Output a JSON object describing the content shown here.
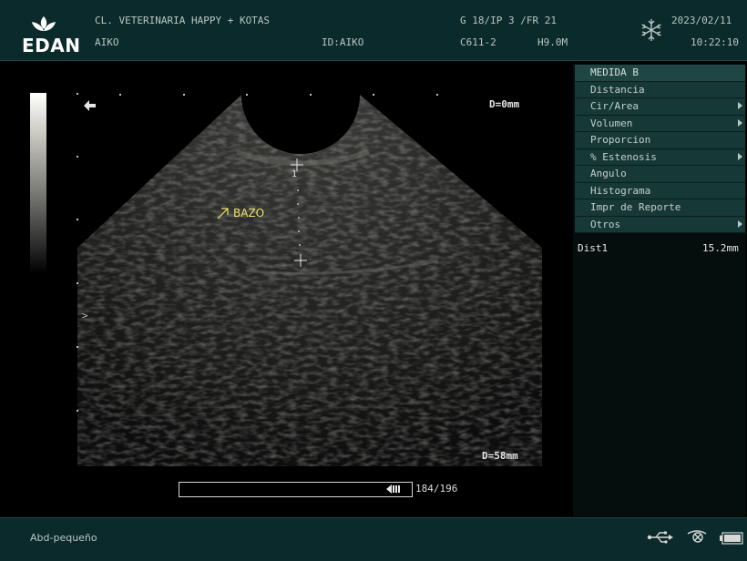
{
  "header": {
    "logo_text": "EDAN",
    "clinic": "CL. VETERINARIA HAPPY + KOTAS",
    "patient": "AIKO",
    "patient_id": "ID:AIKO",
    "params": "G 18/IP 3 /FR 21",
    "probe": "C611-2",
    "frequency": "H9.0M",
    "date": "2023/02/11",
    "time": "10:22:10",
    "freeze_icon": "snowflake-icon"
  },
  "image": {
    "depth_top": "D=0mm",
    "depth_bottom": "D=58mm",
    "annotation": "BAZO",
    "measure_marker": "1",
    "focus_marker": ">"
  },
  "cine": {
    "counter": "184/196",
    "progress_fraction": 0.94
  },
  "menu": {
    "title": "MEDIDA B",
    "items": [
      {
        "label": "Distancia",
        "submenu": false
      },
      {
        "label": "Cir/Area",
        "submenu": true
      },
      {
        "label": "Volumen",
        "submenu": true
      },
      {
        "label": "Proporcion",
        "submenu": false
      },
      {
        "label": "% Estenosis",
        "submenu": true
      },
      {
        "label": "Angulo",
        "submenu": false
      },
      {
        "label": "Histograma",
        "submenu": false
      },
      {
        "label": "Impr de Reporte",
        "submenu": false
      },
      {
        "label": "Otros",
        "submenu": true
      }
    ]
  },
  "results": {
    "label": "Dist1",
    "value": "15.2mm"
  },
  "footer": {
    "preset": "Abd-pequeño",
    "icons": [
      "usb-icon",
      "probe-icon",
      "battery-icon"
    ]
  },
  "colors": {
    "bar_bg": "#0b2a2b",
    "menu_bg": "#163836",
    "annotation": "#f0e66a"
  }
}
